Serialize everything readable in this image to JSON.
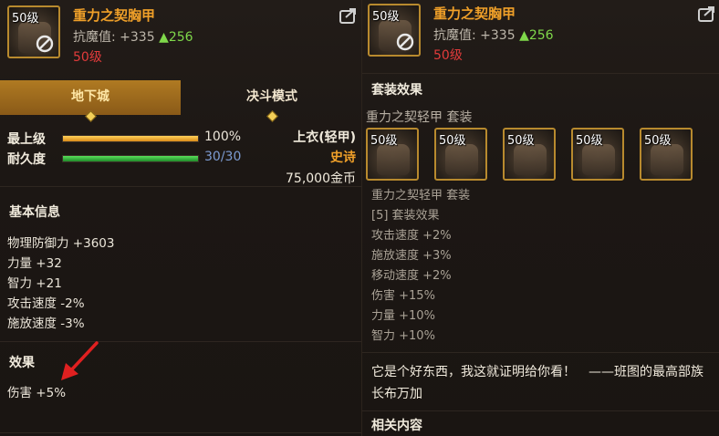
{
  "left_panel": {
    "item": {
      "level_badge": "50级",
      "name": "重力之契胸甲",
      "stat_label": "抗魔值: +335",
      "stat_up": "▲256",
      "required_level": "50级"
    },
    "tabs": [
      {
        "label": "地下城",
        "active": true
      },
      {
        "label": "决斗模式",
        "active": false
      }
    ],
    "bars": {
      "upgrade": {
        "label": "最上级",
        "value_text": "100%",
        "fraction": 1.0
      },
      "durability": {
        "label": "耐久度",
        "value_text": "30/30",
        "fraction": 1.0
      }
    },
    "item_type": {
      "slot": "上衣(轻甲)",
      "rarity": "史诗",
      "price": "75,000金币"
    },
    "basic_info": {
      "title": "基本信息",
      "stats": [
        "物理防御力 +3603",
        "力量 +32",
        "智力 +21",
        "攻击速度 -2%",
        "施放速度 -3%"
      ]
    },
    "effects": {
      "title": "效果",
      "items": [
        "伤害 +5%"
      ]
    }
  },
  "right_panel": {
    "item": {
      "level_badge": "50级",
      "name": "重力之契胸甲",
      "stat_label": "抗魔值: +335",
      "stat_up": "▲256",
      "required_level": "50级"
    },
    "set_section_title": "套装效果",
    "set_name": "重力之契轻甲 套装",
    "set_pieces": [
      "50级",
      "50级",
      "50级",
      "50级",
      "50级"
    ],
    "set_detail": [
      "重力之契轻甲 套装",
      "[5] 套装效果",
      "攻击速度 +2%",
      "施放速度 +3%",
      "移动速度 +2%",
      "伤害 +15%",
      "力量 +10%",
      "智力 +10%"
    ],
    "flavor_text": "它是个好东西，我这就证明给你看！　——班图的最高部族长布万加",
    "related_title": "相关内容"
  },
  "colors": {
    "item_name": "#f0a029",
    "stat_up": "#7fd84a",
    "required_level": "#e23b3b",
    "epic": "#f0a029",
    "durability_text": "#7c9bd1",
    "tab_active": "#a06c1e",
    "arrow": "#e02020"
  },
  "icons": [
    "forbidden-icon",
    "export-icon",
    "tab-diamond-icon",
    "red-arrow-annotation"
  ]
}
